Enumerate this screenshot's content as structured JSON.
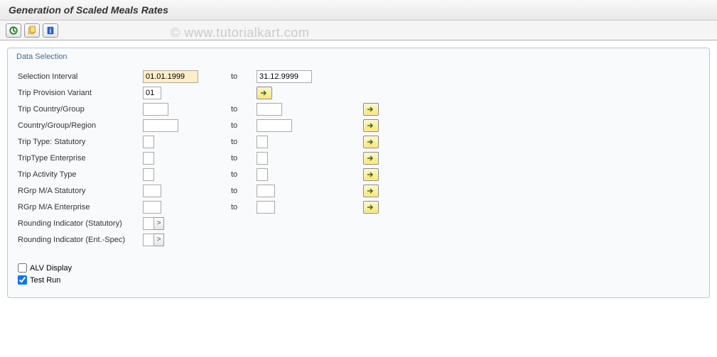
{
  "title": "Generation of Scaled Meals Rates",
  "watermark": "© www.tutorialkart.com",
  "toolbar": {
    "icons": [
      "execute",
      "get-variant",
      "info"
    ]
  },
  "group": {
    "title": "Data Selection",
    "to_label": "to",
    "rows": {
      "selection_interval": {
        "label": "Selection Interval",
        "from": "01.01.1999",
        "to": "31.12.9999"
      },
      "trip_provision_variant": {
        "label": "Trip Provision Variant",
        "from": "01"
      },
      "trip_country_group": {
        "label": "Trip Country/Group",
        "from": "",
        "to": ""
      },
      "country_group_region": {
        "label": "Country/Group/Region",
        "from": "",
        "to": ""
      },
      "trip_type_statutory": {
        "label": "Trip Type: Statutory",
        "from": "",
        "to": ""
      },
      "trip_type_enterprise": {
        "label": "TripType Enterprise",
        "from": "",
        "to": ""
      },
      "trip_activity_type": {
        "label": "Trip Activity Type",
        "from": "",
        "to": ""
      },
      "rgrp_ma_statutory": {
        "label": "RGrp M/A Statutory",
        "from": "",
        "to": ""
      },
      "rgrp_ma_enterprise": {
        "label": "RGrp M/A Enterprise",
        "from": "",
        "to": ""
      },
      "rounding_statutory": {
        "label": "Rounding Indicator (Statutory)",
        "value": ""
      },
      "rounding_enterprise": {
        "label": "Rounding Indicator (Ent.-Spec)",
        "value": ""
      }
    },
    "checkboxes": {
      "alv_display": {
        "label": "ALV Display",
        "checked": false
      },
      "test_run": {
        "label": "Test Run",
        "checked": true
      }
    }
  }
}
